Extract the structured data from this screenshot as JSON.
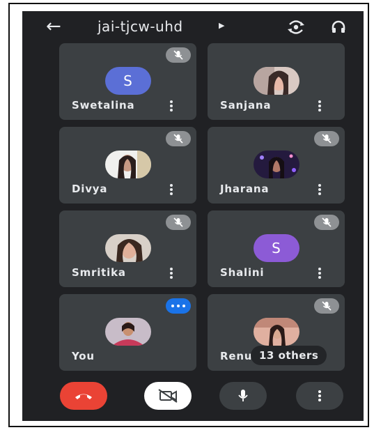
{
  "header": {
    "back_icon": "arrow-left-icon",
    "meeting_code": "jai-tjcw-uhd",
    "caret_icon": "caret-right-icon",
    "switch_camera_icon": "switch-camera-icon",
    "audio_output_icon": "headphones-icon"
  },
  "participants": [
    {
      "name": "Swetalina",
      "avatar_type": "letter",
      "avatar_letter": "S",
      "avatar_color": "#5b6fd6",
      "muted": true
    },
    {
      "name": "Sanjana",
      "avatar_type": "photo",
      "muted": false
    },
    {
      "name": "Divya",
      "avatar_type": "photo",
      "muted": true
    },
    {
      "name": "Jharana",
      "avatar_type": "photo",
      "muted": true
    },
    {
      "name": "Smritika",
      "avatar_type": "photo",
      "muted": true
    },
    {
      "name": "Shalini",
      "avatar_type": "letter",
      "avatar_letter": "S",
      "avatar_color": "#8c5bd6",
      "muted": true
    },
    {
      "name": "You",
      "avatar_type": "photo",
      "speaking": true
    },
    {
      "name": "Renu",
      "avatar_type": "photo",
      "muted": true,
      "overflow_label": "13 others"
    }
  ],
  "controls": {
    "end_call_icon": "end-call-icon",
    "camera_off_icon": "camera-off-icon",
    "microphone_icon": "microphone-icon",
    "more_icon": "more-vertical-icon"
  },
  "colors": {
    "background": "#202124",
    "tile": "#3c4043",
    "end_call": "#ea4335",
    "speaking_badge": "#1a73e8",
    "mute_badge": "#8e9194"
  }
}
